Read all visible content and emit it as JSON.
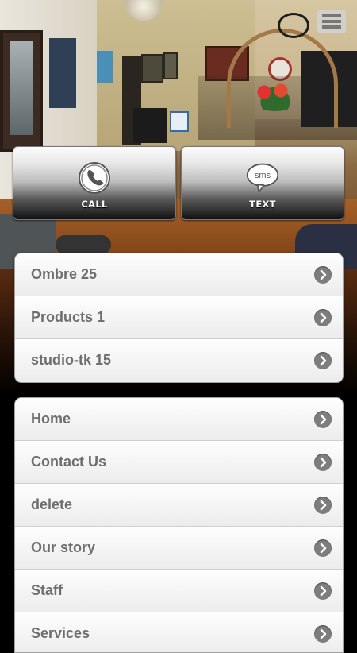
{
  "actions": {
    "call": {
      "label": "CALL",
      "icon": "phone-icon"
    },
    "text": {
      "label": "TEXT",
      "icon": "sms-bubble-icon",
      "icon_text": "sms"
    }
  },
  "categories": [
    {
      "label": "Ombre 25"
    },
    {
      "label": "Products 1"
    },
    {
      "label": "studio-tk 15"
    }
  ],
  "menu": [
    {
      "label": "Home"
    },
    {
      "label": "Contact Us"
    },
    {
      "label": "delete"
    },
    {
      "label": "Our story"
    },
    {
      "label": "Staff"
    },
    {
      "label": "Services"
    }
  ],
  "colors": {
    "list_text": "#6e6e6e",
    "chevron": "#7d7d7d",
    "background": "#000000"
  }
}
